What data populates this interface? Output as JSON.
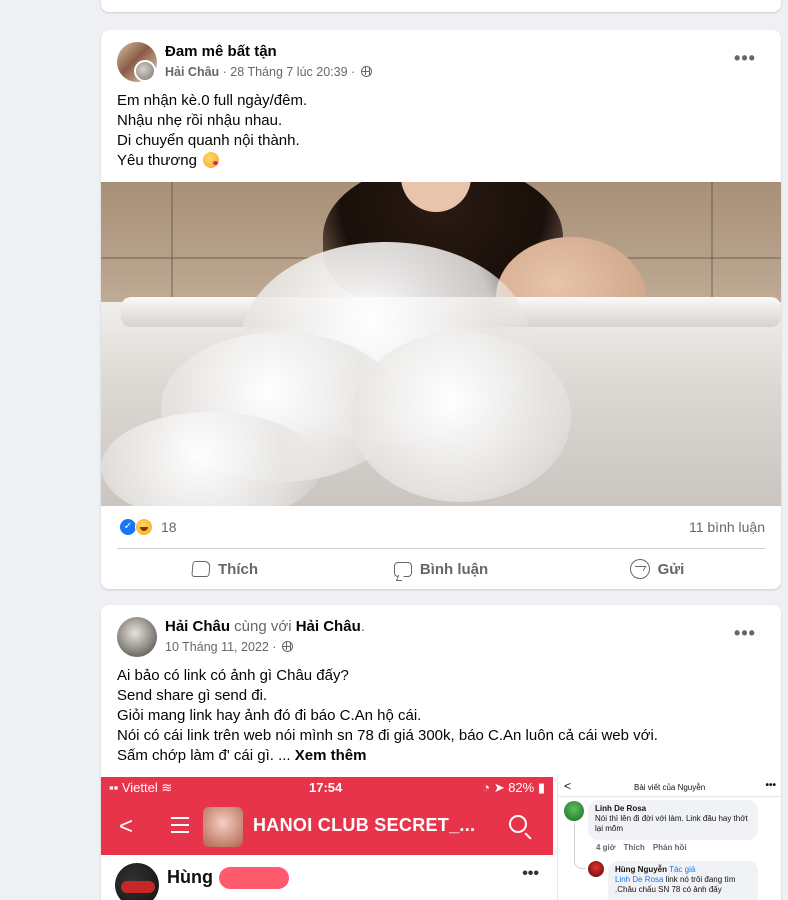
{
  "colors": {
    "page_bg": "#eef0f3",
    "text_primary": "#050505",
    "text_secondary": "#65676b",
    "brand_blue": "#1877f2",
    "phone_red": "#e8344a"
  },
  "post1": {
    "group_name": "Đam mê bất tận",
    "author": "Hải Châu",
    "separator": " · ",
    "timestamp": "28 Tháng 7 lúc 20:39",
    "audience_icon": "group-icon",
    "text_lines": [
      "Em nhận kè.0 full ngày/đêm.",
      "Nhậu nhẹ rồi nhậu nhau.",
      "Di chuyển quanh nội thành.",
      "Yêu thương"
    ],
    "emoji": "kissing-face",
    "reaction_count": "18",
    "comment_count": "11 bình luận",
    "actions": {
      "like": "Thích",
      "comment": "Bình luận",
      "share": "Gửi"
    }
  },
  "post2": {
    "author": "Hải Châu",
    "with_text": " cùng với ",
    "tagged": "Hải Châu",
    "period": ".",
    "timestamp": "10 Tháng 11, 2022",
    "separator": " · ",
    "audience_icon": "globe-icon",
    "text_lines": [
      "Ai bảo có link có ảnh gì Châu đấy?",
      "Send share gì send đi.",
      "Giỏi mang link hay ảnh đó đi báo C.An hộ cái.",
      "Nói có cái link trên web nói mình sn 78 đi giá 300k, báo C.An luôn cả cái web với.",
      "Sấm chớp làm đ' cái gì. ..."
    ],
    "see_more": "Xem thêm",
    "screenshot": {
      "carrier": "Viettel",
      "time": "17:54",
      "battery": "82%",
      "club_name": "HANOI CLUB SECRET_...",
      "user_name": "Hùng",
      "chat_title": "Bài viết của Nguyễn",
      "comment1_name": "Linh De Rosa",
      "comment1_text": "Nói thì lên đi đời với làm. Link đâu hay thớt lại mõm",
      "comment1_time": "4 giờ",
      "comment1_like": "Thích",
      "comment1_reply": "Phản hồi",
      "comment2_name": "Hùng Nguyễn",
      "comment2_badge": "Tác giả",
      "comment2_mention": "Linh De Rosa",
      "comment2_text": "link nó trôi đang tìm .Châu chấu SN 78 có ảnh đấy"
    }
  }
}
